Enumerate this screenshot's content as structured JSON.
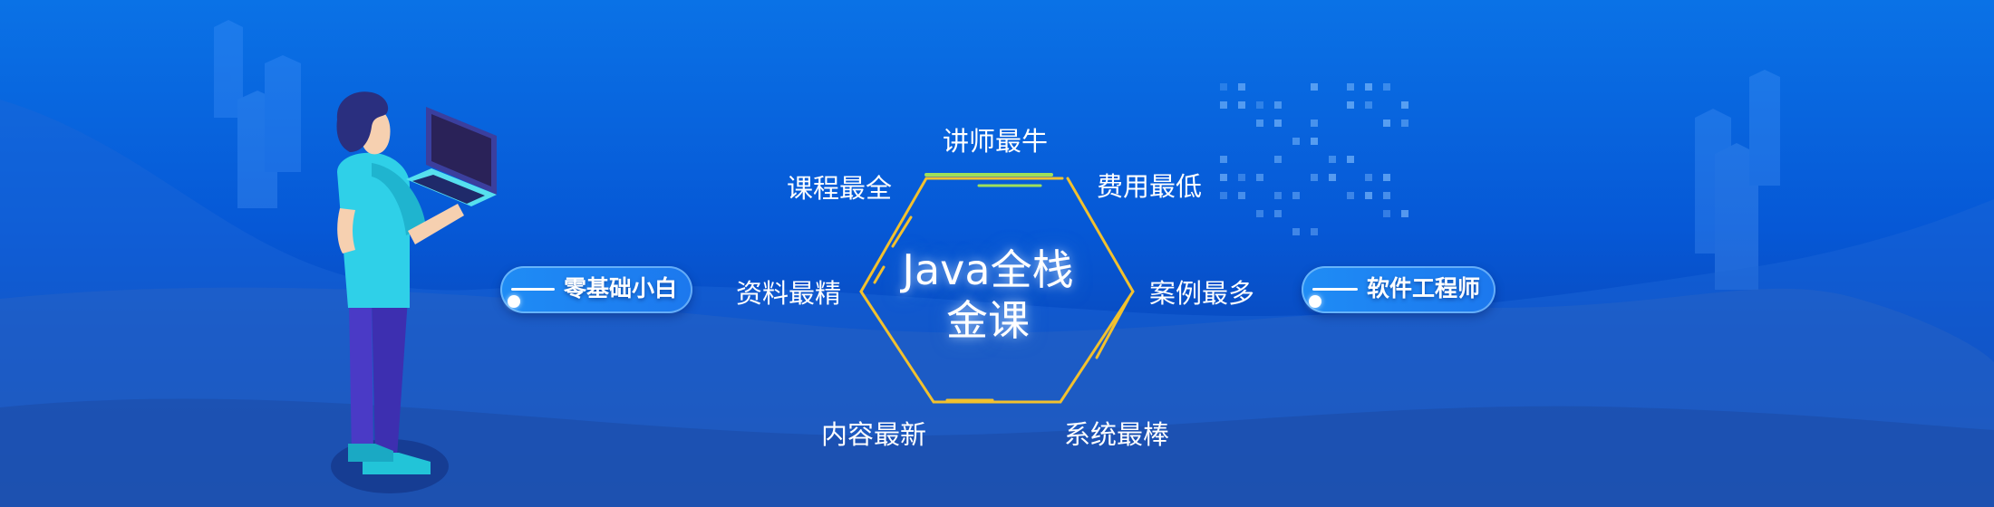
{
  "banner": {
    "center_title_line1": "Java全栈",
    "center_title_line2": "金课",
    "features": {
      "top": "讲师最牛",
      "top_left": "课程最全",
      "top_right": "费用最低",
      "mid_left": "资料最精",
      "mid_right": "案例最多",
      "bottom_left": "内容最新",
      "bottom_right": "系统最棒"
    },
    "left_pill": "零基础小白",
    "right_pill": "软件工程师"
  },
  "colors": {
    "background_top": "#0a72e6",
    "background_bottom": "#123f9c",
    "hexagon_gold": "#f2c12e",
    "hexagon_green": "#9fe05a",
    "shirt_cyan": "#2fd0e8",
    "pants_purple": "#4a3ac6"
  }
}
